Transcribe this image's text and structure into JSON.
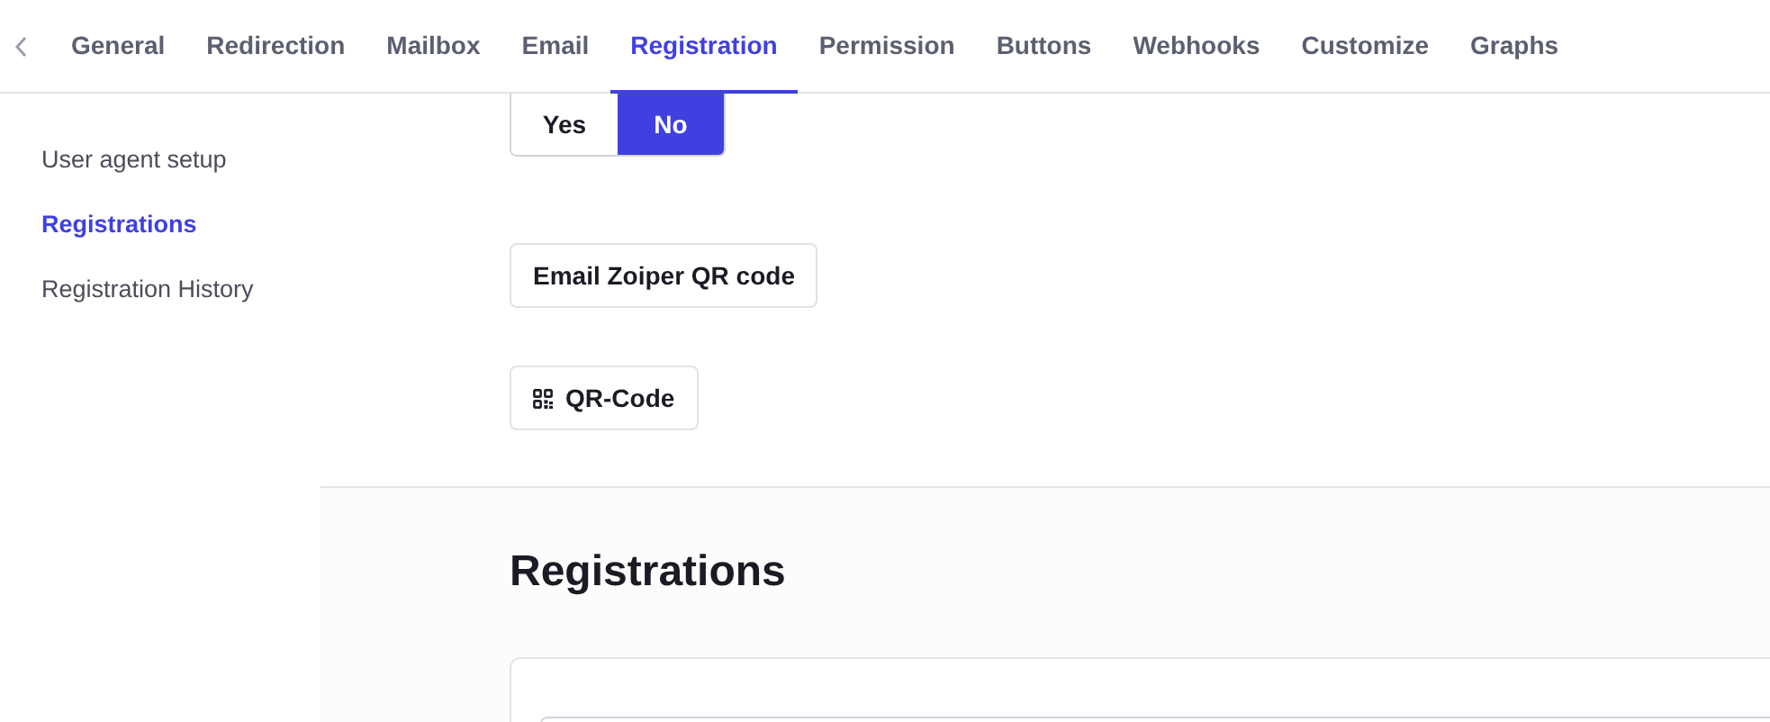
{
  "tabs": [
    {
      "label": "General",
      "selected": false
    },
    {
      "label": "Redirection",
      "selected": false
    },
    {
      "label": "Mailbox",
      "selected": false
    },
    {
      "label": "Email",
      "selected": false
    },
    {
      "label": "Registration",
      "selected": true
    },
    {
      "label": "Permission",
      "selected": false
    },
    {
      "label": "Buttons",
      "selected": false
    },
    {
      "label": "Webhooks",
      "selected": false
    },
    {
      "label": "Customize",
      "selected": false
    },
    {
      "label": "Graphs",
      "selected": false
    }
  ],
  "sidebar": {
    "items": [
      {
        "label": "User agent setup",
        "selected": false
      },
      {
        "label": "Registrations",
        "selected": true
      },
      {
        "label": "Registration History",
        "selected": false
      }
    ]
  },
  "toggle": [
    {
      "label": "Yes",
      "selected": false
    },
    {
      "label": "No",
      "selected": true
    }
  ],
  "email_qr_button": "Email Zoiper QR code",
  "qr_button": "QR-Code",
  "section_title": "Registrations"
}
